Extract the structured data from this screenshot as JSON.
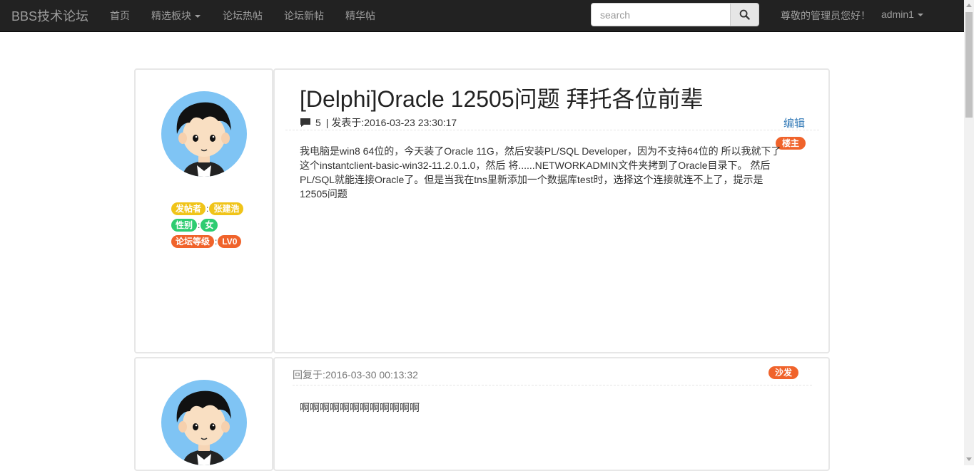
{
  "navbar": {
    "brand": "BBS技术论坛",
    "links": [
      "首页",
      "精选板块",
      "论坛热帖",
      "论坛新帖",
      "精华帖"
    ],
    "search_placeholder": "search",
    "greeting": "尊敬的管理员您好！",
    "username": "admin1"
  },
  "post": {
    "title": "[Delphi]Oracle 12505问题 拜托各位前辈",
    "reply_count": "5",
    "posted_at": "| 发表于:2016-03-23 23:30:17",
    "edit_label": "编辑",
    "floor_badge": "楼主",
    "body": "我电脑是win8 64位的，今天装了Oracle 11G，然后安装PL/SQL Developer，因为不支持64位的 所以我就下了这个instantclient-basic-win32-11.2.0.1.0，然后 将......NETWORKADMIN文件夹拷到了Oracle目录下。 然后PL/SQL就能连接Oracle了。但是当我在tns里新添加一个数据库test时，选择这个连接就连不上了，提示是12505问题",
    "author": {
      "poster_label": "发帖者",
      "poster_name": "张建浩",
      "gender_label": "性别",
      "gender_value": "女",
      "level_label": "论坛等级",
      "level_value": "LV0",
      "separator": ":"
    }
  },
  "reply": {
    "time": "回复于:2016-03-30 00:13:32",
    "floor_badge": "沙发",
    "body": "啊啊啊啊啊啊啊啊啊啊啊啊"
  },
  "colors": {
    "navbar_bg": "#222222",
    "label_yellow": "#f0c419",
    "label_green": "#2ecc71",
    "label_red": "#f0632b",
    "link_blue": "#337ab7"
  }
}
